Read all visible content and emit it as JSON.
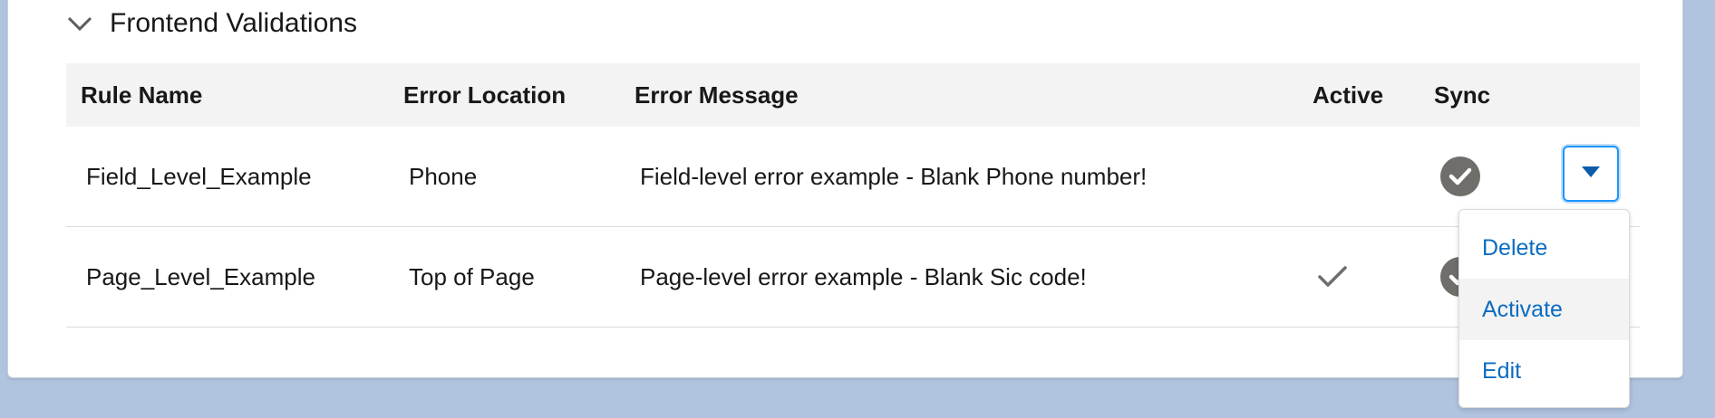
{
  "section": {
    "title": "Frontend Validations"
  },
  "table": {
    "columns": {
      "rule_name": "Rule Name",
      "error_location": "Error Location",
      "error_message": "Error Message",
      "active": "Active",
      "sync": "Sync"
    },
    "rows": [
      {
        "rule_name": "Field_Level_Example",
        "error_location": "Phone",
        "error_message": "Field-level error example - Blank Phone number!",
        "active": false,
        "synced": true
      },
      {
        "rule_name": "Page_Level_Example",
        "error_location": "Top of Page",
        "error_message": "Page-level error example - Blank Sic code!",
        "active": true,
        "synced": true
      }
    ]
  },
  "row_menu": {
    "items": [
      "Delete",
      "Activate",
      "Edit"
    ],
    "highlighted": "Activate"
  },
  "colors": {
    "page_background": "#b0c4df",
    "header_background": "#f3f3f3",
    "link_blue": "#0b6cc1",
    "icon_gray": "#706e6b",
    "focus_blue": "#1b96ff"
  },
  "icons": {
    "section_toggle": "chevron-down-icon",
    "sync": "check-circle-icon",
    "active": "check-icon",
    "row_action": "caret-down-icon"
  }
}
